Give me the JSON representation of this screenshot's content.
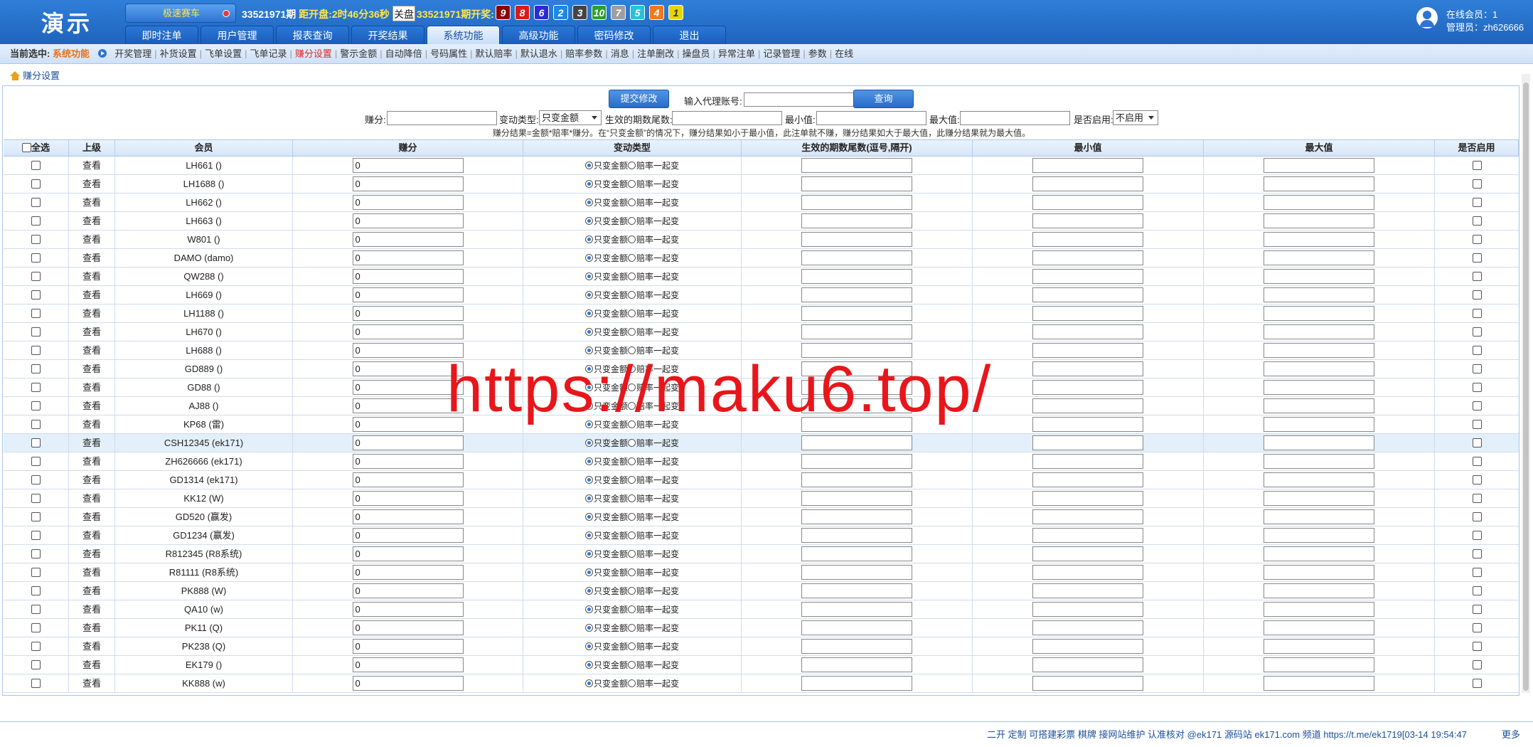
{
  "header": {
    "logo": "演示",
    "game_button": "极速赛车",
    "period": "33521971期",
    "countdown_label": "距开盘:",
    "countdown_value": "2时46分36秒",
    "close_button": "关盘",
    "draw_period": "33521971期开奖:",
    "balls": [
      {
        "n": "9",
        "color": "#8b0000"
      },
      {
        "n": "8",
        "color": "#d81b1b"
      },
      {
        "n": "6",
        "color": "#2b2bd6"
      },
      {
        "n": "2",
        "color": "#1e88e5"
      },
      {
        "n": "3",
        "color": "#444444"
      },
      {
        "n": "10",
        "color": "#2e9e2e"
      },
      {
        "n": "7",
        "color": "#9e9e9e"
      },
      {
        "n": "5",
        "color": "#29c1d8"
      },
      {
        "n": "4",
        "color": "#ef7a1a"
      },
      {
        "n": "1",
        "color": "#e6d600"
      }
    ],
    "tabs": [
      "即时注单",
      "用户管理",
      "报表查询",
      "开奖结果",
      "系统功能",
      "高级功能",
      "密码修改",
      "退出"
    ],
    "active_tab": "系统功能",
    "online": "在线会员：1",
    "admin": "管理员：zh626666"
  },
  "subnav": {
    "current_label": "当前选中:",
    "current_value": "系统功能",
    "items": [
      "开奖管理",
      "补货设置",
      "飞单设置",
      "飞单记录",
      "赚分设置",
      "警示金额",
      "自动降倍",
      "号码属性",
      "默认赔率",
      "默认退水",
      "赔率参数",
      "消息",
      "注单删改",
      "操盘员",
      "异常注单",
      "记录管理",
      "参数",
      "在线"
    ],
    "active_item": "赚分设置"
  },
  "breadcrumb": "赚分设置",
  "form": {
    "submit_button": "提交修改",
    "agent_label": "输入代理账号:",
    "agent_value": "",
    "query_button": "查询",
    "earn_label": "赚分:",
    "earn_value": "",
    "change_type_label": "变动类型:",
    "change_type_value": "只变金额",
    "suffix_label": "生效的期数尾数:",
    "suffix_value": "",
    "min_label": "最小值:",
    "min_value": "",
    "max_label": "最大值:",
    "max_value": "",
    "enable_label": "是否启用:",
    "enable_value": "不启用",
    "note": "赚分结果=金额*赔率*赚分。在“只变金额”的情况下，赚分结果如小于最小值，此注单就不赚，赚分结果如大于最大值，此赚分结果就为最大值。"
  },
  "table": {
    "headers": [
      "全选",
      "上级",
      "会员",
      "赚分",
      "变动类型",
      "生效的期数尾数(逗号,隔开)",
      "最小值",
      "最大值",
      "是否启用"
    ],
    "view_label": "查看",
    "radio_a": "只变金额",
    "radio_b": "赔率一起变",
    "highlighted_row": 15,
    "rows": [
      {
        "member": "LH661 ()",
        "earn": "0"
      },
      {
        "member": "LH1688 ()",
        "earn": "0"
      },
      {
        "member": "LH662 ()",
        "earn": "0"
      },
      {
        "member": "LH663 ()",
        "earn": "0"
      },
      {
        "member": "W801 ()",
        "earn": "0"
      },
      {
        "member": "DAMO (damo)",
        "earn": "0"
      },
      {
        "member": "QW288 ()",
        "earn": "0"
      },
      {
        "member": "LH669 ()",
        "earn": "0"
      },
      {
        "member": "LH1188 ()",
        "earn": "0"
      },
      {
        "member": "LH670 ()",
        "earn": "0"
      },
      {
        "member": "LH688 ()",
        "earn": "0"
      },
      {
        "member": "GD889 ()",
        "earn": "0"
      },
      {
        "member": "GD88 ()",
        "earn": "0"
      },
      {
        "member": "AJ88 ()",
        "earn": "0"
      },
      {
        "member": "KP68 (雷)",
        "earn": "0"
      },
      {
        "member": "CSH12345 (ek171)",
        "earn": "0"
      },
      {
        "member": "ZH626666 (ek171)",
        "earn": "0"
      },
      {
        "member": "GD1314 (ek171)",
        "earn": "0"
      },
      {
        "member": "KK12 (W)",
        "earn": "0"
      },
      {
        "member": "GD520 (赢发)",
        "earn": "0"
      },
      {
        "member": "GD1234 (赢发)",
        "earn": "0"
      },
      {
        "member": "R812345 (R8系统)",
        "earn": "0"
      },
      {
        "member": "R81111 (R8系统)",
        "earn": "0"
      },
      {
        "member": "PK888 (W)",
        "earn": "0"
      },
      {
        "member": "QA10 (w)",
        "earn": "0"
      },
      {
        "member": "PK11 (Q)",
        "earn": "0"
      },
      {
        "member": "PK238 (Q)",
        "earn": "0"
      },
      {
        "member": "EK179 ()",
        "earn": "0"
      },
      {
        "member": "KK888 (w)",
        "earn": "0"
      }
    ]
  },
  "watermark": "https://maku6.top/",
  "footer": {
    "text": "二开 定制 可搭建彩票 棋牌 接网站维护 认准核对 @ek171 源码站 ek171.com 频道 https://t.me/ek1719[03-14 19:54:47",
    "more": "更多"
  }
}
